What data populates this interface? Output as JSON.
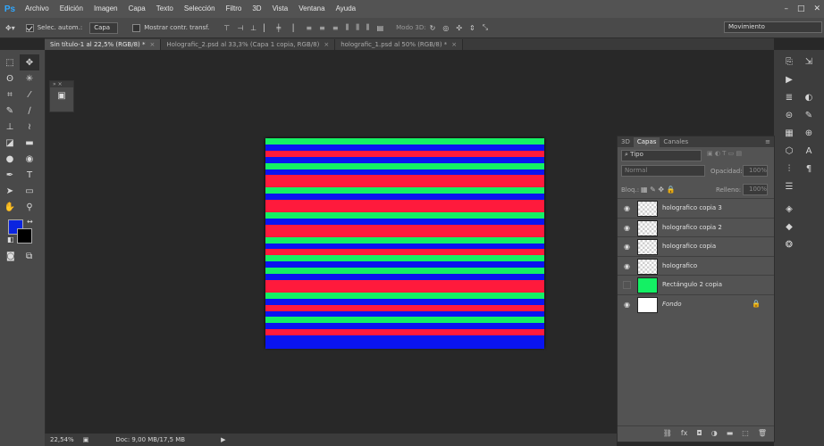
{
  "app": {
    "logo": "Ps"
  },
  "menu": [
    "Archivo",
    "Edición",
    "Imagen",
    "Capa",
    "Texto",
    "Selección",
    "Filtro",
    "3D",
    "Vista",
    "Ventana",
    "Ayuda"
  ],
  "window_controls": [
    "–",
    "□",
    "✕"
  ],
  "options_bar": {
    "autoselect_label": "Selec. autom.:",
    "autoselect_value": "Capa",
    "transform_label": "Mostrar contr. transf.",
    "mode3d_label": "Modo 3D:",
    "workspace": "Movimiento"
  },
  "tabs": [
    {
      "label": "Sin título-1 al 22,5% (RGB/8) *",
      "active": true
    },
    {
      "label": "Holografic_2.psd al 33,3% (Capa 1 copia, RGB/8)",
      "active": false
    },
    {
      "label": "holografic_1.psd al 50% (RGB/8) *",
      "active": false
    }
  ],
  "tools": [
    [
      "marquee-icon",
      "move-icon"
    ],
    [
      "lasso-icon",
      "magic-wand-icon"
    ],
    [
      "crop-icon",
      "eyedropper-icon"
    ],
    [
      "healing-icon",
      "brush-icon"
    ],
    [
      "stamp-icon",
      "history-brush-icon"
    ],
    [
      "eraser-icon",
      "gradient-icon"
    ],
    [
      "blur-icon",
      "dodge-icon"
    ],
    [
      "pen-icon",
      "type-icon"
    ],
    [
      "path-select-icon",
      "shape-icon"
    ],
    [
      "hand-icon",
      "zoom-icon"
    ]
  ],
  "colors": {
    "foreground": "#0a24e0",
    "background": "#000000",
    "red": "#ff1a3c",
    "green": "#14f064",
    "blue": "#0a14f0"
  },
  "canvas_stripes": [
    "green",
    "blue",
    "red",
    "blue",
    "green",
    "blue",
    "red",
    "red",
    "green",
    "blue",
    "red",
    "red",
    "green",
    "blue",
    "red",
    "red",
    "green",
    "blue",
    "red",
    "green",
    "blue",
    "green",
    "blue",
    "red",
    "red",
    "green",
    "blue",
    "red",
    "blue",
    "green",
    "blue",
    "red",
    "blue",
    "blue"
  ],
  "layers_panel": {
    "tabs": [
      "3D",
      "Capas",
      "Canales"
    ],
    "filter": "Tipo",
    "blend_mode": "Normal",
    "opacity_label": "Opacidad:",
    "opacity_value": "100%",
    "lock_label": "Bloq.:",
    "fill_label": "Relleno:",
    "fill_value": "100%",
    "layers": [
      {
        "name": "holografico copia 3",
        "visible": true,
        "thumb": "checker"
      },
      {
        "name": "holografico copia 2",
        "visible": true,
        "thumb": "checker"
      },
      {
        "name": "holografico copia",
        "visible": true,
        "thumb": "checker"
      },
      {
        "name": "holografico",
        "visible": true,
        "thumb": "checker"
      },
      {
        "name": "Rectángulo 2 copia",
        "visible": false,
        "thumb": "green"
      },
      {
        "name": "Fondo",
        "visible": true,
        "thumb": "white",
        "locked": true
      }
    ]
  },
  "status": {
    "zoom": "22,54%",
    "doc": "Doc: 9,00 MB/17,5 MB"
  }
}
